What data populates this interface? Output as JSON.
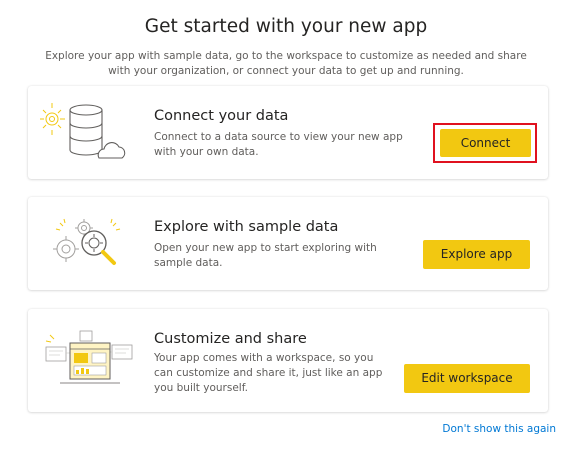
{
  "header": {
    "title": "Get started with your new app",
    "subtitle": "Explore your app with sample data, go to the workspace to customize as needed and share with your organization, or connect your data to get up and running."
  },
  "cards": [
    {
      "title": "Connect your data",
      "description": "Connect to a data source to view your new app with your own data.",
      "button_label": "Connect",
      "icon": "database-cloud-icon"
    },
    {
      "title": "Explore with sample data",
      "description": "Open your new app to start exploring with sample data.",
      "button_label": "Explore app",
      "icon": "gears-magnifier-icon"
    },
    {
      "title": "Customize and share",
      "description": "Your app comes with a workspace, so you can customize and share it, just like an app you built yourself.",
      "button_label": "Edit workspace",
      "icon": "dashboard-share-icon"
    }
  ],
  "footer": {
    "link_label": "Don't show this again"
  },
  "colors": {
    "button_bg": "#F2C811",
    "highlight_border": "#E0111F",
    "link": "#0078D4"
  }
}
